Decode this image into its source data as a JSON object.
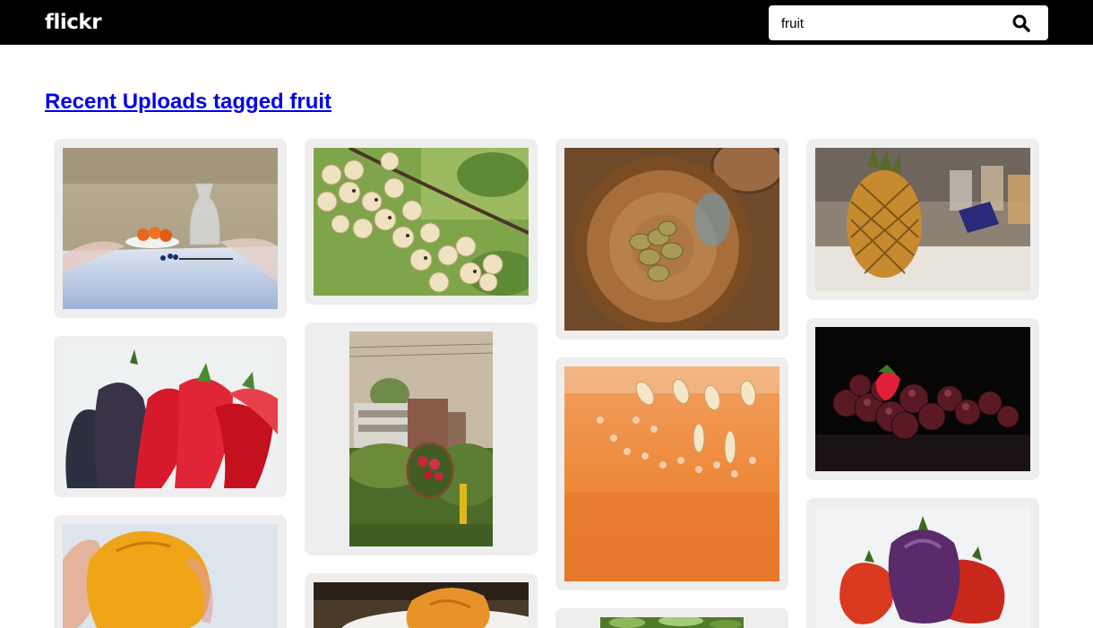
{
  "app": {
    "logo": "flickr"
  },
  "search": {
    "value": "fruit",
    "icon": "search-icon"
  },
  "heading": "Recent Uploads tagged fruit",
  "photos": [
    {
      "id": "p1",
      "icon": "still-life-photo"
    },
    {
      "id": "p2",
      "icon": "white-currants-photo"
    },
    {
      "id": "p3",
      "icon": "kiwi-bowl-photo"
    },
    {
      "id": "p4",
      "icon": "pineapple-photo"
    },
    {
      "id": "p5",
      "icon": "peppers-photo"
    },
    {
      "id": "p6",
      "icon": "garden-photo"
    },
    {
      "id": "p7",
      "icon": "melon-closeup-photo"
    },
    {
      "id": "p8",
      "icon": "grapes-strawberry-photo"
    },
    {
      "id": "p9",
      "icon": "yellow-tomato-hand-photo"
    },
    {
      "id": "p10",
      "icon": "tomato-plate-photo"
    },
    {
      "id": "p11",
      "icon": "greenery-photo"
    },
    {
      "id": "p12",
      "icon": "bell-peppers-photo"
    }
  ]
}
